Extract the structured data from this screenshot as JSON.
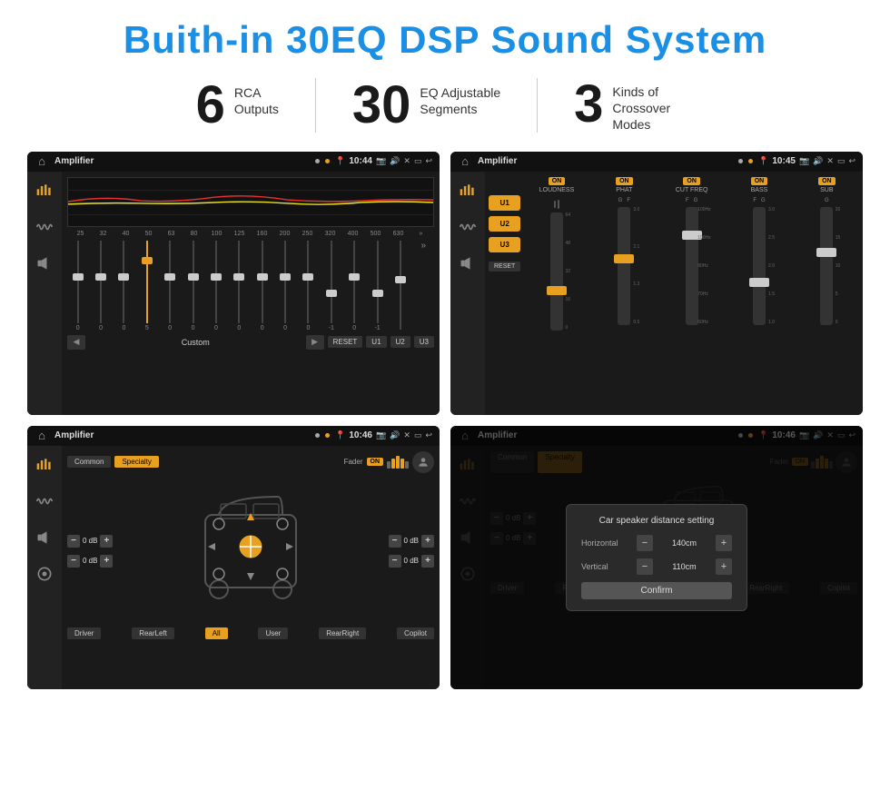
{
  "title": "Buith-in 30EQ DSP Sound System",
  "stats": [
    {
      "number": "6",
      "label": "RCA\nOutputs"
    },
    {
      "number": "30",
      "label": "EQ Adjustable\nSegments"
    },
    {
      "number": "3",
      "label": "Kinds of\nCrossover Modes"
    }
  ],
  "screens": {
    "eq_screen": {
      "time": "10:44",
      "title": "Amplifier",
      "freqs": [
        "25",
        "32",
        "40",
        "50",
        "63",
        "80",
        "100",
        "125",
        "160",
        "200",
        "250",
        "320",
        "400",
        "500",
        "630"
      ],
      "values": [
        "0",
        "0",
        "0",
        "5",
        "0",
        "0",
        "0",
        "0",
        "0",
        "0",
        "0",
        "-1",
        "0",
        "-1",
        ""
      ],
      "preset": "Custom",
      "buttons": [
        "RESET",
        "U1",
        "U2",
        "U3"
      ]
    },
    "amp_screen": {
      "time": "10:45",
      "title": "Amplifier",
      "presets": [
        "U1",
        "U2",
        "U3"
      ],
      "controls": [
        "LOUDNESS",
        "PHAT",
        "CUT FREQ",
        "BASS",
        "SUB"
      ],
      "reset": "RESET"
    },
    "crossover_screen": {
      "time": "10:46",
      "title": "Amplifier",
      "tabs": [
        "Common",
        "Specialty"
      ],
      "fader_label": "Fader",
      "fader_on": "ON",
      "vol_left_top": "0 dB",
      "vol_left_bottom": "0 dB",
      "vol_right_top": "0 dB",
      "vol_right_bottom": "0 dB",
      "buttons_bottom": [
        "Driver",
        "All",
        "User",
        "RearLeft",
        "RearRight",
        "Copilot"
      ]
    },
    "modal_screen": {
      "time": "10:46",
      "title": "Amplifier",
      "modal_title": "Car speaker distance setting",
      "horizontal_label": "Horizontal",
      "horizontal_value": "140cm",
      "vertical_label": "Vertical",
      "vertical_value": "110cm",
      "confirm_label": "Confirm"
    }
  }
}
